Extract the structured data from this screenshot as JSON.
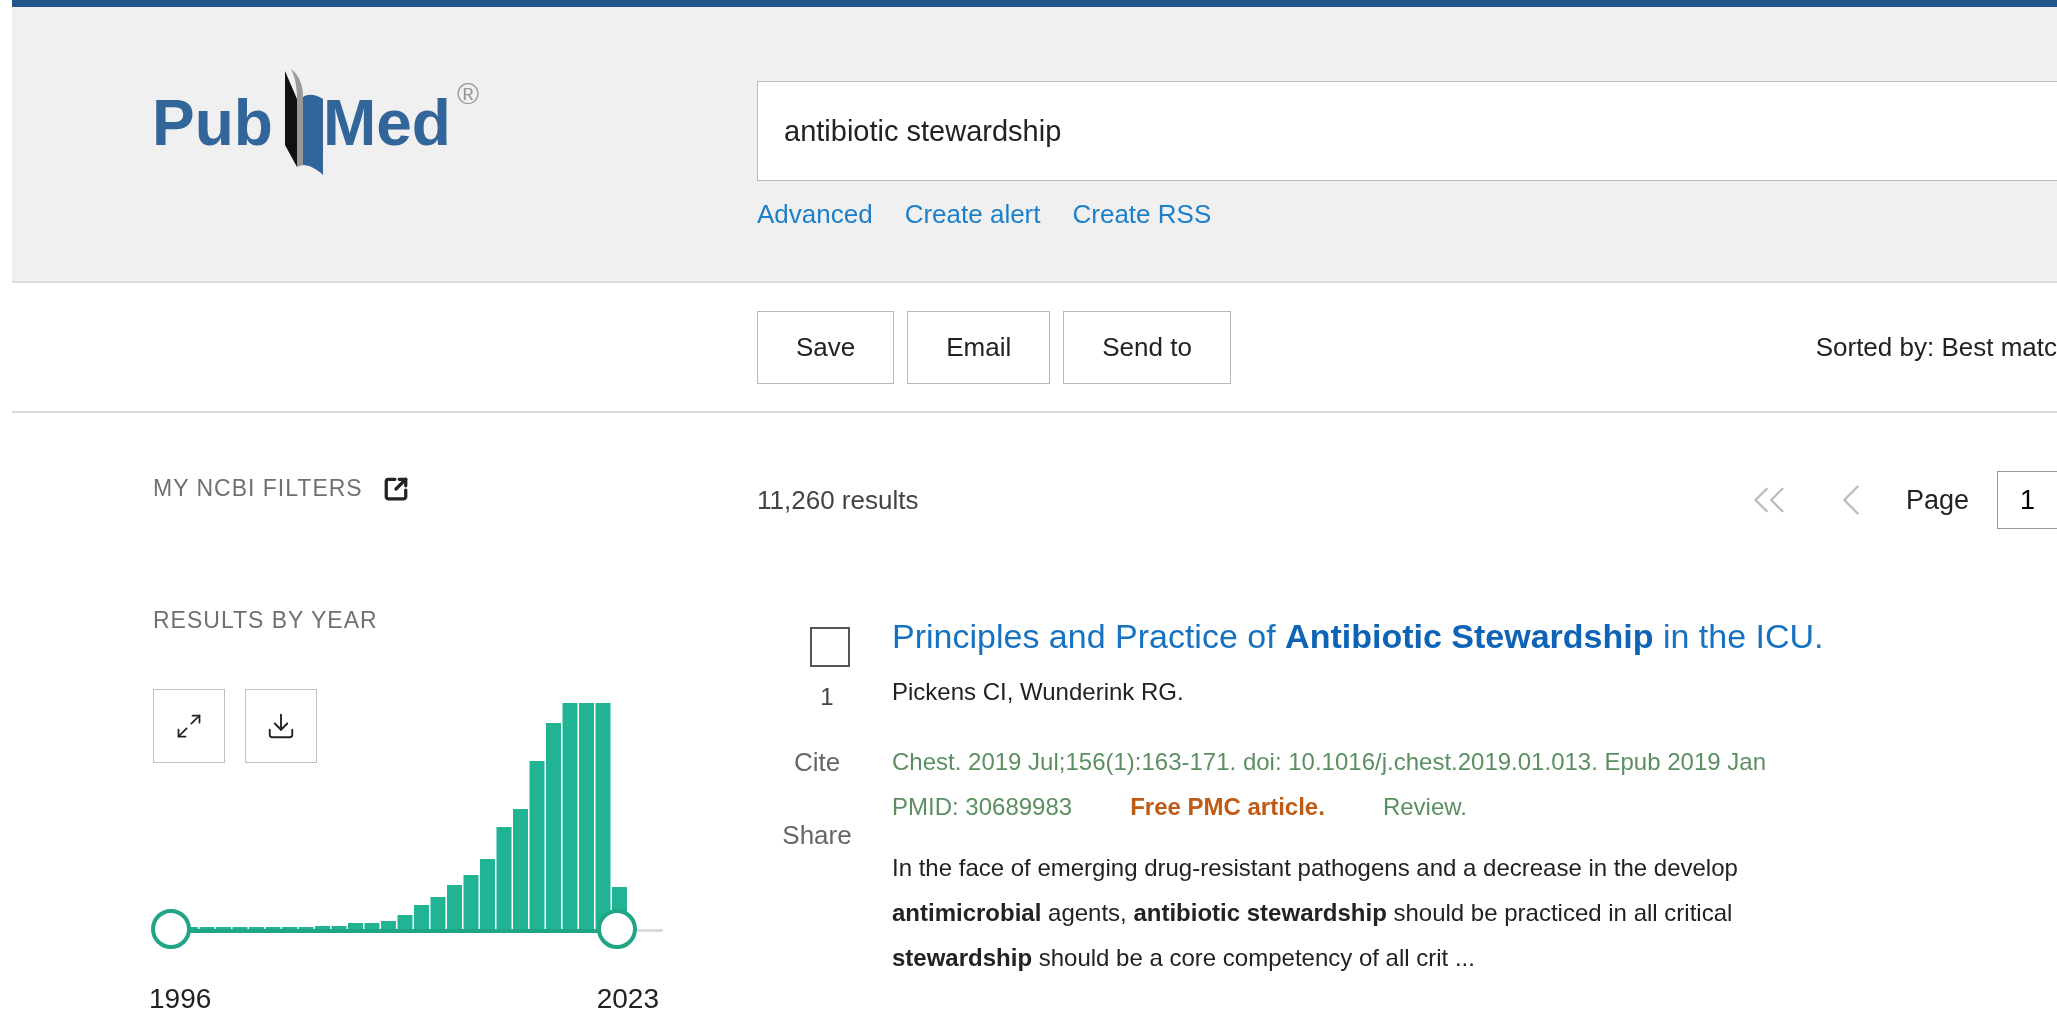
{
  "header": {
    "logo": {
      "left": "Pub",
      "right": "Med",
      "mark": "®"
    },
    "search": {
      "value": "antibiotic stewardship"
    },
    "links": [
      "Advanced",
      "Create alert",
      "Create RSS"
    ]
  },
  "actions": {
    "buttons": [
      "Save",
      "Email",
      "Send to"
    ],
    "sort": "Sorted by: Best matc"
  },
  "sidebar": {
    "filters_title": "MY NCBI FILTERS",
    "year_title": "RESULTS BY YEAR",
    "year_start": "1996",
    "year_end": "2023"
  },
  "results": {
    "count": "11,260 results",
    "pager": {
      "label": "Page",
      "value": "1"
    },
    "items": [
      {
        "checked": false,
        "number": "1",
        "cite": "Cite",
        "share": "Share",
        "title": "Principles and Practice of **Antibiotic Stewardship** in the ICU.",
        "authors": "Pickens CI, Wunderink RG.",
        "citation": "Chest. 2019 Jul;156(1):163-171. doi: 10.1016/j.chest.2019.01.013. Epub 2019 Jan",
        "pmid": "PMID: 30689983",
        "free": "Free PMC article.",
        "type": "Review.",
        "snippet": [
          "In the face of emerging drug-resistant pathogens and a decrease in the develop",
          "**antimicrobial** agents, **antibiotic stewardship** should be practiced in all critical",
          "**stewardship** should be a core competency of all crit ..."
        ]
      }
    ]
  }
}
